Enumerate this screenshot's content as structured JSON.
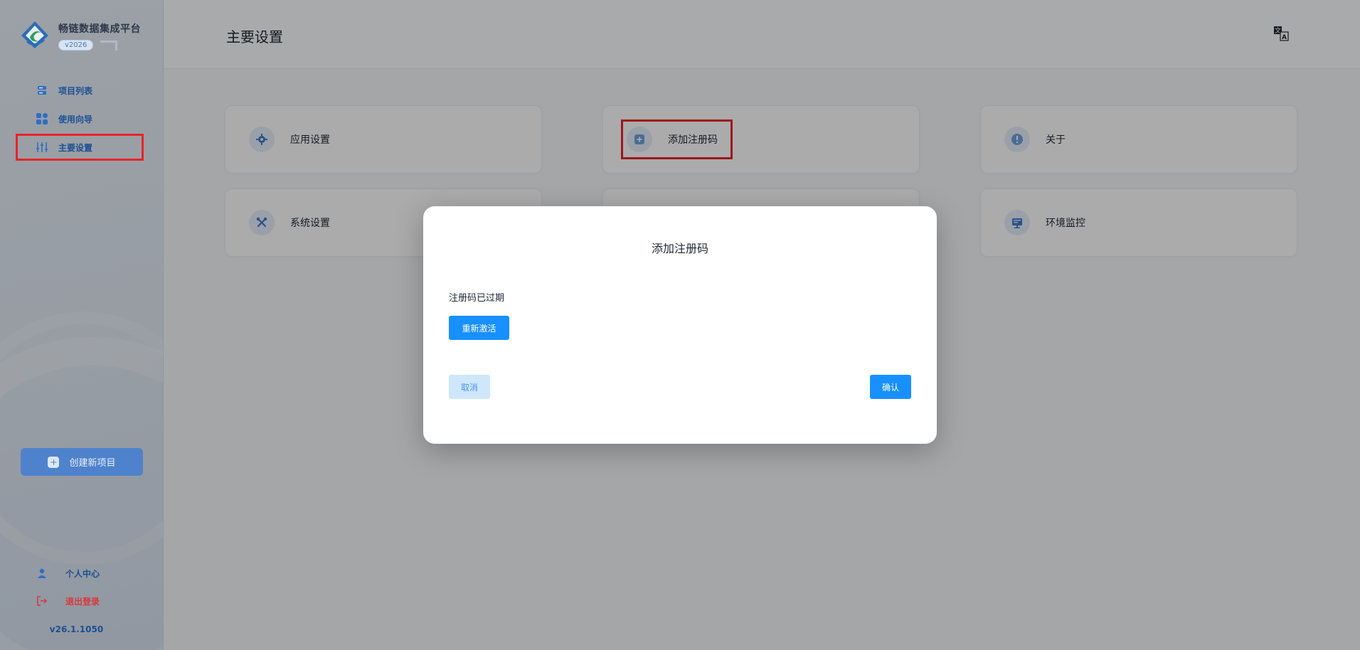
{
  "sidebar": {
    "brand_name": "畅链数据集成平台",
    "brand_version": "v2026",
    "nav": [
      {
        "label": "项目列表",
        "icon": "server-list-icon"
      },
      {
        "label": "使用向导",
        "icon": "grid-apps-icon"
      },
      {
        "label": "主要设置",
        "icon": "sliders-icon",
        "active": true
      }
    ],
    "create_label": "创建新项目",
    "profile_label": "个人中心",
    "logout_label": "退出登录",
    "app_version": "v26.1.1050"
  },
  "header": {
    "title": "主要设置",
    "language_icon": "translate-icon"
  },
  "cards": [
    {
      "label": "应用设置",
      "icon": "gear-icon"
    },
    {
      "label": "添加注册码",
      "icon": "plus-square-icon",
      "highlighted": true
    },
    {
      "label": "关于",
      "icon": "info-icon"
    },
    {
      "label": "系统设置",
      "icon": "tools-icon"
    },
    {
      "label": "",
      "icon": ""
    },
    {
      "label": "环境监控",
      "icon": "monitor-icon"
    }
  ],
  "dialog": {
    "title": "添加注册码",
    "message": "注册码已过期",
    "reactivate_label": "重新激活",
    "cancel_label": "取消",
    "confirm_label": "确认"
  },
  "colors": {
    "primary": "#1890ff",
    "highlight": "#e8232a",
    "nav_text": "#1b4f94",
    "logout": "#d93838"
  }
}
